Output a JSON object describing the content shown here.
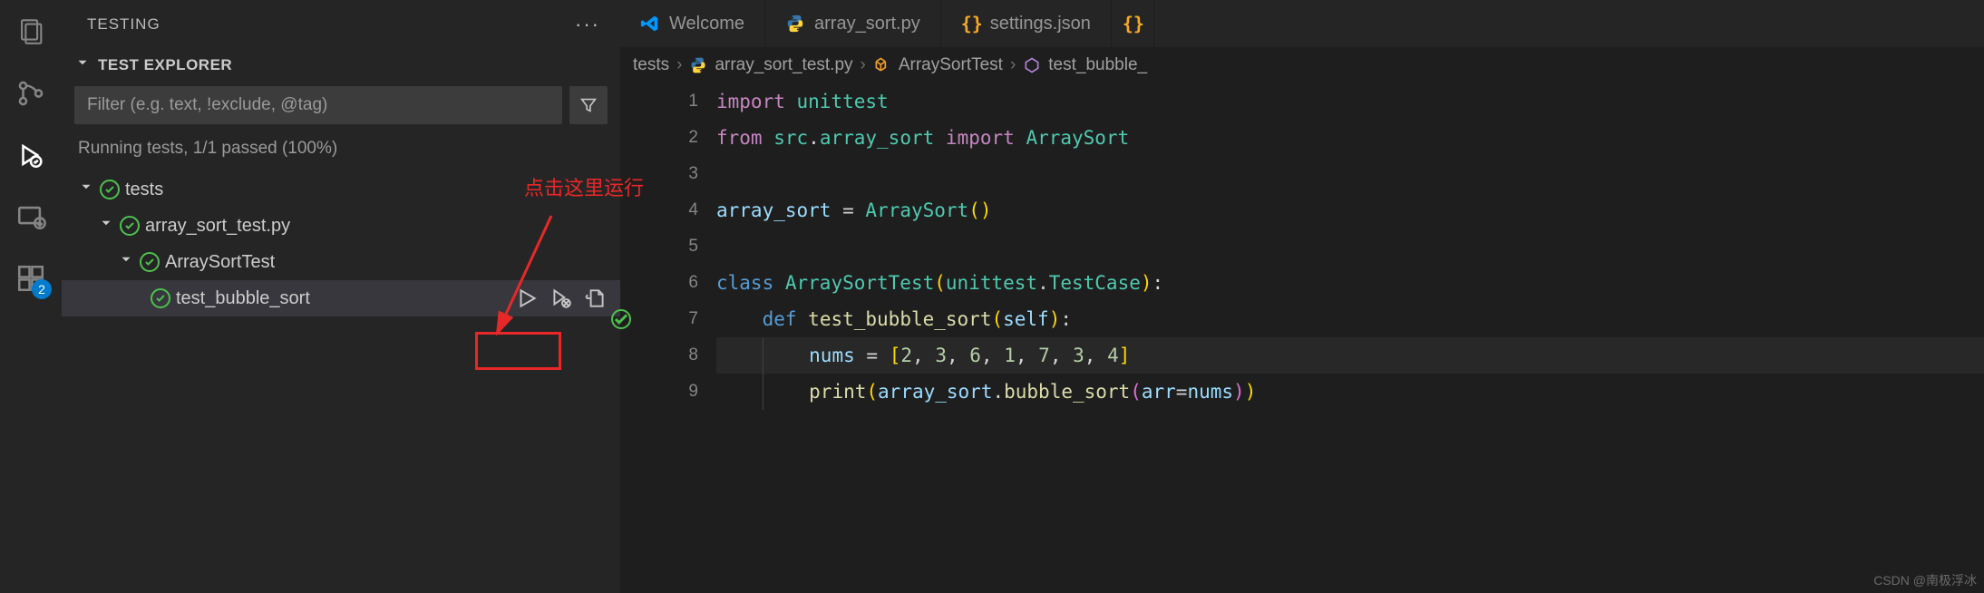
{
  "sidebar": {
    "title": "TESTING",
    "section": "TEST EXPLORER",
    "filter_placeholder": "Filter (e.g. text, !exclude, @tag)",
    "status": "Running tests, 1/1 passed (100%)",
    "tree": {
      "root": "tests",
      "file": "array_sort_test.py",
      "class": "ArraySortTest",
      "test": "test_bubble_sort"
    }
  },
  "activity_badge": "2",
  "tabs": [
    {
      "label": "Welcome",
      "icon": "vscode"
    },
    {
      "label": "array_sort.py",
      "icon": "python"
    },
    {
      "label": "settings.json",
      "icon": "json"
    }
  ],
  "breadcrumb": {
    "folder": "tests",
    "file": "array_sort_test.py",
    "class": "ArraySortTest",
    "method": "test_bubble_"
  },
  "code": {
    "lines": [
      "1",
      "2",
      "3",
      "4",
      "5",
      "6",
      "7",
      "8",
      "9"
    ]
  },
  "annotation": "点击这里运行",
  "watermark": "CSDN @南极浮冰"
}
